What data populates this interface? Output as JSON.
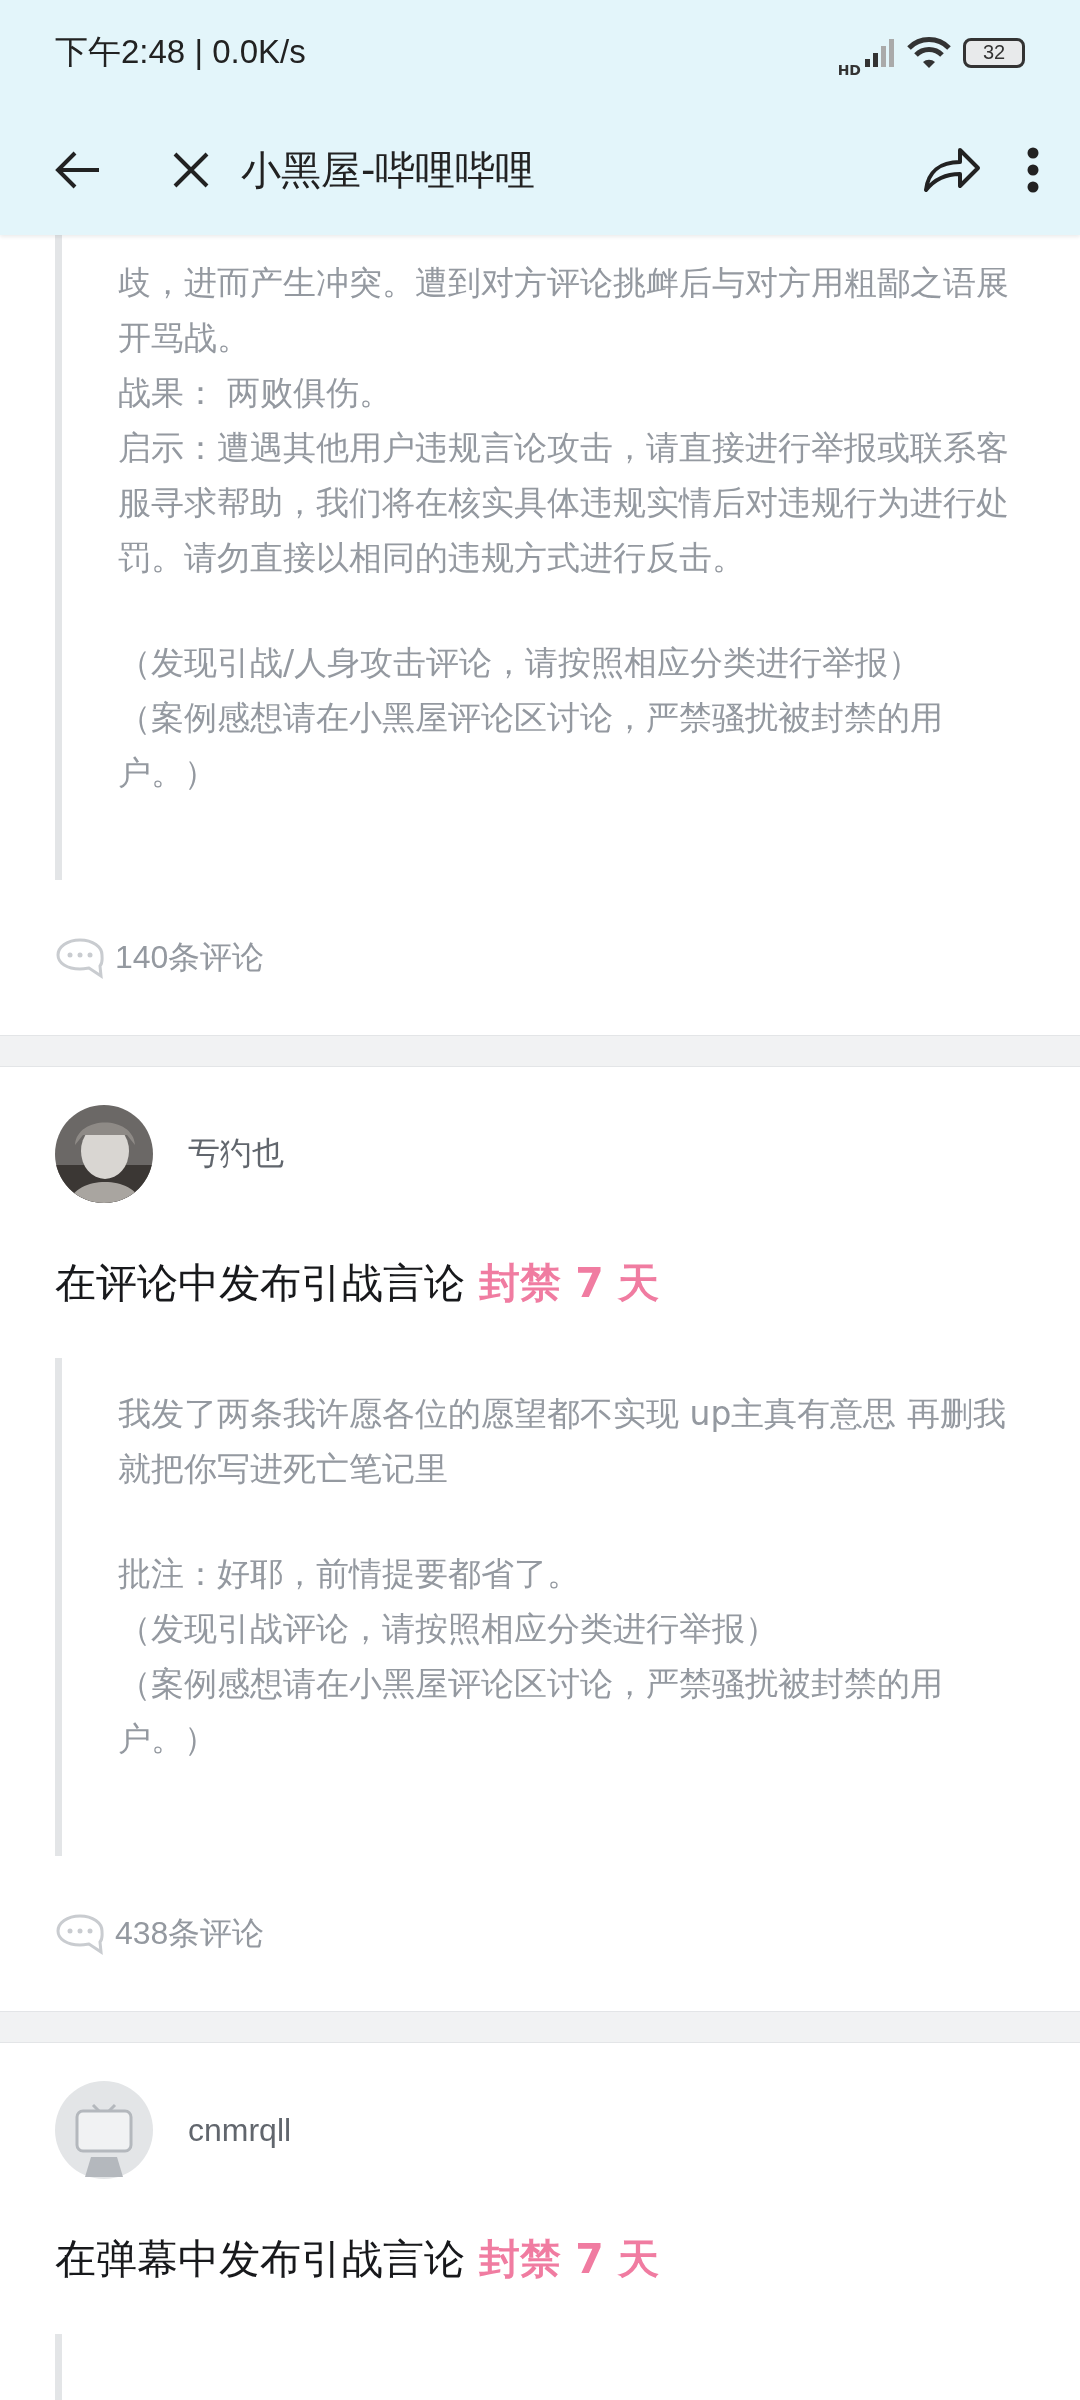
{
  "status_bar": {
    "time": "下午2:48 | 0.0K/s",
    "network": "HD",
    "battery": "32"
  },
  "header": {
    "title": "小黑屋-哔哩哔哩"
  },
  "cases": [
    {
      "blocks": [
        [
          "歧，进而产生冲突。遭到对方评论挑衅后与对方用粗鄙之语展开骂战。",
          "战果：  两败俱伤。",
          "启示：遭遇其他用户违规言论攻击，请直接进行举报或联系客服寻求帮助，我们将在核实具体违规实情后对违规行为进行处罚。请勿直接以相同的违规方式进行反击。"
        ],
        [
          "（发现引战/人身攻击评论，请按照相应分类进行举报）",
          "（案例感想请在小黑屋评论区讨论，严禁骚扰被封禁的用户。）"
        ]
      ],
      "comment_count": "140条评论"
    },
    {
      "user": {
        "name": "亐犳也"
      },
      "violation": "在评论中发布引战言论",
      "penalty": "封禁 7 天",
      "blocks": [
        [
          "我发了两条我许愿各位的愿望都不实现 up主真有意思 再删我就把你写进死亡笔记里"
        ],
        [
          "批注：好耶，前情提要都省了。",
          "（发现引战评论，请按照相应分类进行举报）",
          "（案例感想请在小黑屋评论区讨论，严禁骚扰被封禁的用户。）"
        ]
      ],
      "comment_count": "438条评论"
    },
    {
      "user": {
        "name": "cnmrqll",
        "avatar": {
          "kind": "default"
        }
      },
      "violation": "在弹幕中发布引战言论",
      "penalty": "封禁 7 天"
    }
  ]
}
